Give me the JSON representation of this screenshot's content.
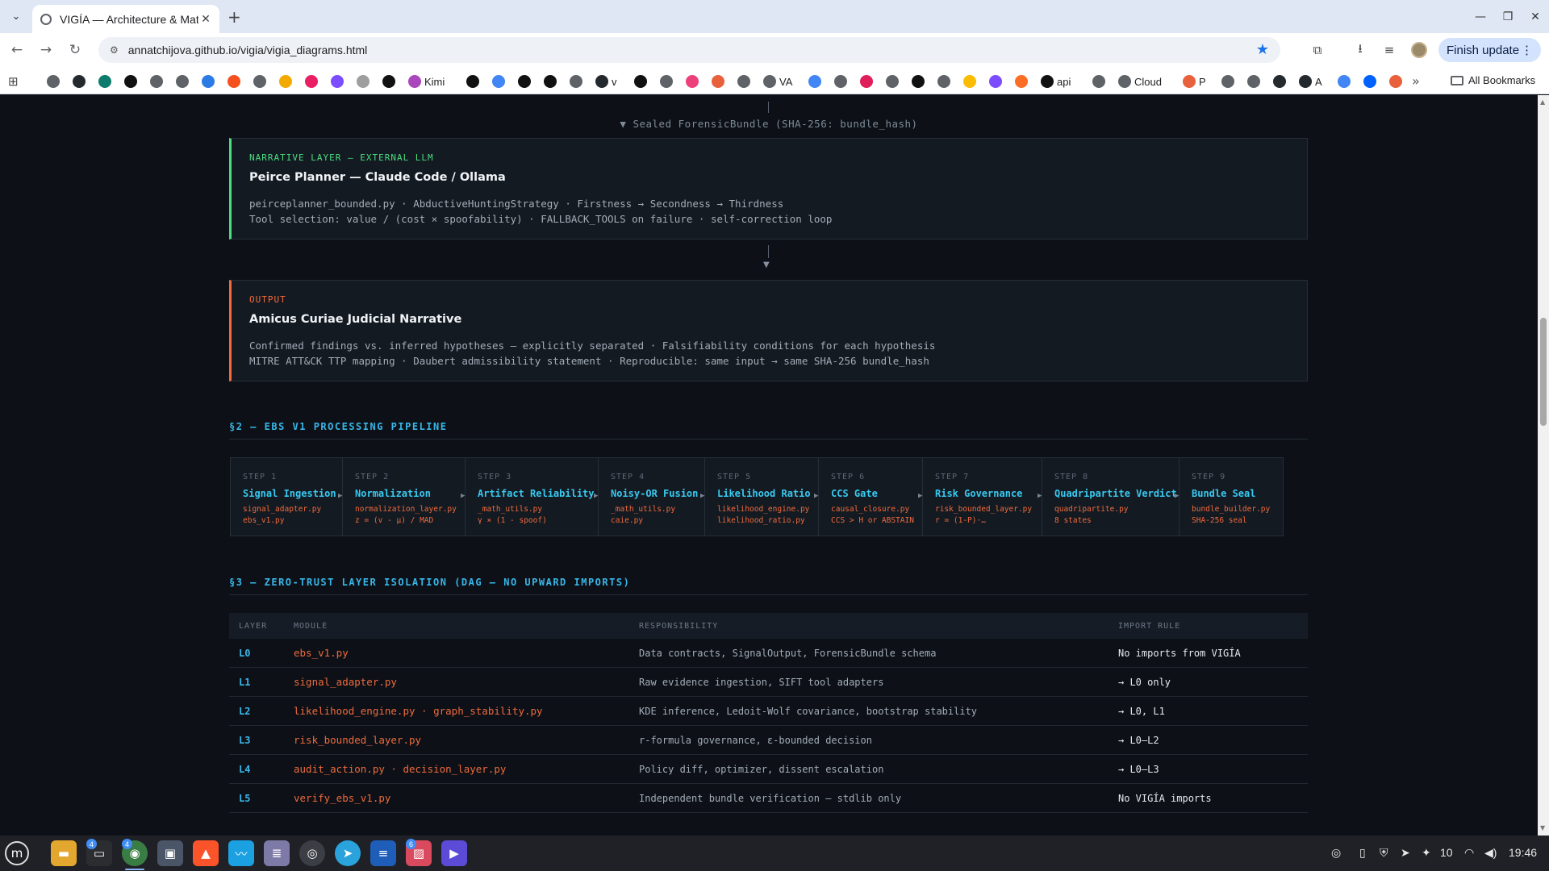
{
  "browser": {
    "tab_title": "VIGÍA — Architecture & Math",
    "url": "annatchijova.github.io/vigia/vigia_diagrams.html",
    "finish_update": "Finish update",
    "all_bookmarks": "All Bookmarks",
    "bookmarks": [
      {
        "label": "",
        "icon": "link-icon",
        "color": "#5f6368"
      },
      {
        "label": "",
        "icon": "github-icon",
        "color": "#24292e"
      },
      {
        "label": "",
        "icon": "app-icon",
        "color": "#0f7b6c"
      },
      {
        "label": "",
        "icon": "openai-icon",
        "color": "#111111"
      },
      {
        "label": "",
        "icon": "globe-icon",
        "color": "#5f6368"
      },
      {
        "label": "",
        "icon": "globe-icon",
        "color": "#5f6368"
      },
      {
        "label": "",
        "icon": "app-icon",
        "color": "#2c7be5"
      },
      {
        "label": "",
        "icon": "app-icon",
        "color": "#f4511e"
      },
      {
        "label": "",
        "icon": "globe-icon",
        "color": "#5f6368"
      },
      {
        "label": "",
        "icon": "stack-icon",
        "color": "#f2a900"
      },
      {
        "label": "",
        "icon": "app-icon",
        "color": "#e91e63"
      },
      {
        "label": "",
        "icon": "app-icon",
        "color": "#7c4dff"
      },
      {
        "label": "",
        "icon": "x-icon",
        "color": "#9e9e9e"
      },
      {
        "label": "",
        "icon": "triangle-icon",
        "color": "#111111"
      },
      {
        "label": "Kimi",
        "icon": "app-icon",
        "color": "#ab47bc"
      },
      {
        "label": "",
        "icon": "app-icon",
        "color": "#111111"
      },
      {
        "label": "",
        "icon": "sparkle-icon",
        "color": "#4285f4"
      },
      {
        "label": "",
        "icon": "triangle-icon",
        "color": "#111111"
      },
      {
        "label": "",
        "icon": "app-icon",
        "color": "#111111"
      },
      {
        "label": "",
        "icon": "globe-icon",
        "color": "#5f6368"
      },
      {
        "label": "v",
        "icon": "github-icon",
        "color": "#24292e"
      },
      {
        "label": "",
        "icon": "app-icon",
        "color": "#111111"
      },
      {
        "label": "",
        "icon": "globe-icon",
        "color": "#5f6368"
      },
      {
        "label": "",
        "icon": "app-icon",
        "color": "#ec407a"
      },
      {
        "label": "",
        "icon": "asterisk-icon",
        "color": "#e8603c"
      },
      {
        "label": "",
        "icon": "link-icon",
        "color": "#5f6368"
      },
      {
        "label": "VA",
        "icon": "globe-icon",
        "color": "#5f6368"
      },
      {
        "label": "",
        "icon": "sparkle-icon",
        "color": "#4285f4"
      },
      {
        "label": "",
        "icon": "globe-icon",
        "color": "#5f6368"
      },
      {
        "label": "",
        "icon": "slack-icon",
        "color": "#e01e5a"
      },
      {
        "label": "",
        "icon": "gear-icon",
        "color": "#5f6368"
      },
      {
        "label": "",
        "icon": "app-icon",
        "color": "#111111"
      },
      {
        "label": "",
        "icon": "gear-icon",
        "color": "#5f6368"
      },
      {
        "label": "",
        "icon": "app-icon",
        "color": "#fbbc04"
      },
      {
        "label": "",
        "icon": "app-icon",
        "color": "#7c4dff"
      },
      {
        "label": "",
        "icon": "gitlab-icon",
        "color": "#fc6d26"
      },
      {
        "label": "api",
        "icon": "app-icon",
        "color": "#111111"
      },
      {
        "label": "",
        "icon": "globe-icon",
        "color": "#5f6368"
      },
      {
        "label": "Cloud",
        "icon": "gear-icon",
        "color": "#5f6368"
      },
      {
        "label": "P",
        "icon": "asterisk-icon",
        "color": "#e8603c"
      },
      {
        "label": "",
        "icon": "gear-icon",
        "color": "#5f6368"
      },
      {
        "label": "",
        "icon": "globe-icon",
        "color": "#5f6368"
      },
      {
        "label": "",
        "icon": "github-icon",
        "color": "#24292e"
      },
      {
        "label": "A",
        "icon": "github-icon",
        "color": "#24292e"
      },
      {
        "label": "",
        "icon": "sparkle-icon",
        "color": "#4285f4"
      },
      {
        "label": "",
        "icon": "app-icon",
        "color": "#0061fe"
      },
      {
        "label": "",
        "icon": "asterisk-icon",
        "color": "#e8603c"
      }
    ]
  },
  "page": {
    "sealed_label": "▼ Sealed ForensicBundle (SHA-256: bundle_hash)",
    "narrative": {
      "kicker": "NARRATIVE LAYER — EXTERNAL LLM",
      "title": "Peirce Planner — Claude Code / Ollama",
      "line1": "peirceplanner_bounded.py · AbductiveHuntingStrategy · Firstness → Secondness → Thirdness",
      "line2": "Tool selection: value / (cost × spoofability) · FALLBACK_TOOLS on failure · self-correction loop"
    },
    "output": {
      "kicker": "OUTPUT",
      "title": "Amicus Curiae Judicial Narrative",
      "line1": "Confirmed findings vs. inferred hypotheses — explicitly separated · Falsifiability conditions for each hypothesis",
      "line2": "MITRE ATT&CK TTP mapping · Daubert admissibility statement · Reproducible: same input → same SHA-256 bundle_hash"
    },
    "section2_title": "§2 — EBS V1 PROCESSING PIPELINE",
    "steps": [
      {
        "num": "STEP 1",
        "name": "Signal Ingestion",
        "d1": "signal_adapter.py",
        "d2": "ebs_v1.py"
      },
      {
        "num": "STEP 2",
        "name": "Normalization",
        "d1": "normalization_layer.py",
        "d2": "z = (v - μ) / MAD"
      },
      {
        "num": "STEP 3",
        "name": "Artifact Reliability",
        "d1": "_math_utils.py",
        "d2": "γ × (1 - spoof)"
      },
      {
        "num": "STEP 4",
        "name": "Noisy-OR Fusion",
        "d1": "_math_utils.py",
        "d2": "caie.py"
      },
      {
        "num": "STEP 5",
        "name": "Likelihood Ratio",
        "d1": "likelihood_engine.py",
        "d2": "likelihood_ratio.py"
      },
      {
        "num": "STEP 6",
        "name": "CCS Gate",
        "d1": "causal_closure.py",
        "d2": "CCS > H or ABSTAIN"
      },
      {
        "num": "STEP 7",
        "name": "Risk Governance",
        "d1": "risk_bounded_layer.py",
        "d2": "r = (1-P)·…"
      },
      {
        "num": "STEP 8",
        "name": "Quadripartite Verdict",
        "d1": "quadripartite.py",
        "d2": "8 states"
      },
      {
        "num": "STEP 9",
        "name": "Bundle Seal",
        "d1": "bundle_builder.py",
        "d2": "SHA-256 seal"
      }
    ],
    "section3_title": "§3 — ZERO-TRUST LAYER ISOLATION (DAG — NO UPWARD IMPORTS)",
    "table": {
      "headers": [
        "LAYER",
        "MODULE",
        "RESPONSIBILITY",
        "IMPORT RULE"
      ],
      "rows": [
        {
          "layer": "L0",
          "module": "ebs_v1.py",
          "resp": "Data contracts, SignalOutput, ForensicBundle schema",
          "rule": "No imports from VIGÍA"
        },
        {
          "layer": "L1",
          "module": "signal_adapter.py",
          "resp": "Raw evidence ingestion, SIFT tool adapters",
          "rule": "→ L0 only"
        },
        {
          "layer": "L2",
          "module": "likelihood_engine.py · graph_stability.py",
          "resp": "KDE inference, Ledoit-Wolf covariance, bootstrap stability",
          "rule": "→ L0, L1"
        },
        {
          "layer": "L3",
          "module": "risk_bounded_layer.py",
          "resp": "r-formula governance, ε-bounded decision",
          "rule": "→ L0–L2"
        },
        {
          "layer": "L4",
          "module": "audit_action.py · decision_layer.py",
          "resp": "Policy diff, optimizer, dissent escalation",
          "rule": "→ L0–L3"
        },
        {
          "layer": "L5",
          "module": "verify_ebs_v1.py",
          "resp": "Independent bundle verification — stdlib only",
          "rule": "No VIGÍA imports"
        }
      ]
    }
  },
  "taskbar": {
    "time": "19:46",
    "notification_count": "10",
    "badges": {
      "terminal": "4",
      "chrome": "4",
      "photos": "6"
    }
  }
}
